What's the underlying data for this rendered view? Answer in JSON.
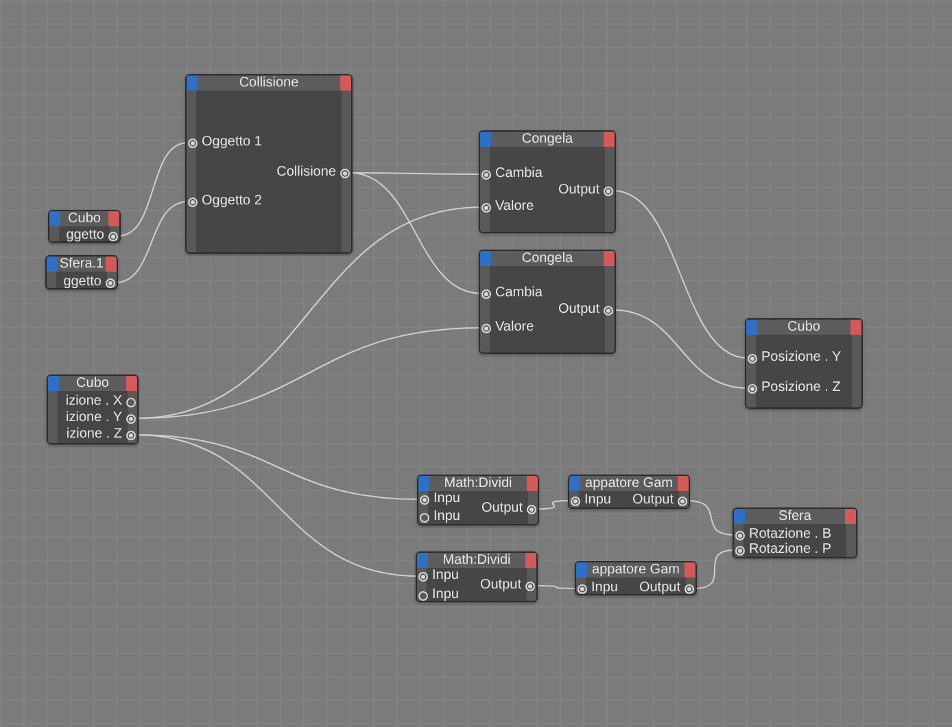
{
  "nodes": [
    {
      "title": "Collisione",
      "ports": [
        {
          "kind": "input",
          "label": "Oggetto 1",
          "connected": true
        },
        {
          "kind": "output",
          "label": "Collisione",
          "connected": true
        },
        {
          "kind": "input",
          "label": "Oggetto 2",
          "connected": true
        }
      ]
    },
    {
      "title": "Cubo",
      "ports": [
        {
          "kind": "output",
          "label": "ggetto",
          "connected": true
        }
      ]
    },
    {
      "title": "Sfera.1",
      "ports": [
        {
          "kind": "output",
          "label": "ggetto",
          "connected": true
        }
      ]
    },
    {
      "title": "Congela",
      "ports": [
        {
          "kind": "input",
          "label": "Cambia",
          "connected": true
        },
        {
          "kind": "output",
          "label": "Output",
          "connected": true
        },
        {
          "kind": "input",
          "label": "Valore",
          "connected": true
        }
      ]
    },
    {
      "title": "Congela",
      "ports": [
        {
          "kind": "input",
          "label": "Cambia",
          "connected": true
        },
        {
          "kind": "output",
          "label": "Output",
          "connected": true
        },
        {
          "kind": "input",
          "label": "Valore",
          "connected": true
        }
      ]
    },
    {
      "title": "Cubo",
      "ports": [
        {
          "kind": "input",
          "label": "Posizione . Y",
          "connected": true
        },
        {
          "kind": "input",
          "label": "Posizione . Z",
          "connected": true
        }
      ]
    },
    {
      "title": "Cubo",
      "ports": [
        {
          "kind": "output",
          "label": "izione . X",
          "connected": false
        },
        {
          "kind": "output",
          "label": "izione . Y",
          "connected": true
        },
        {
          "kind": "output",
          "label": "izione . Z",
          "connected": true
        }
      ]
    },
    {
      "title": "Math:Dividi",
      "ports": [
        {
          "kind": "input",
          "label": "Inpu",
          "connected": true
        },
        {
          "kind": "output",
          "label": "Output",
          "connected": true
        },
        {
          "kind": "input",
          "label": "Inpu",
          "connected": false
        }
      ]
    },
    {
      "title": "appatore Gam",
      "ports": [
        {
          "kind": "input",
          "label": "Inpu",
          "connected": true
        },
        {
          "kind": "output",
          "label": "Output",
          "connected": true
        }
      ]
    },
    {
      "title": "Sfera",
      "ports": [
        {
          "kind": "input",
          "label": "Rotazione . B",
          "connected": true
        },
        {
          "kind": "input",
          "label": "Rotazione . P",
          "connected": true
        }
      ]
    },
    {
      "title": "Math:Dividi",
      "ports": [
        {
          "kind": "input",
          "label": "Inpu",
          "connected": true
        },
        {
          "kind": "output",
          "label": "Output",
          "connected": true
        },
        {
          "kind": "input",
          "label": "Inpu",
          "connected": false
        }
      ]
    },
    {
      "title": "appatore Gam",
      "ports": [
        {
          "kind": "input",
          "label": "Inpu",
          "connected": true
        },
        {
          "kind": "output",
          "label": "Output",
          "connected": true
        }
      ]
    }
  ]
}
